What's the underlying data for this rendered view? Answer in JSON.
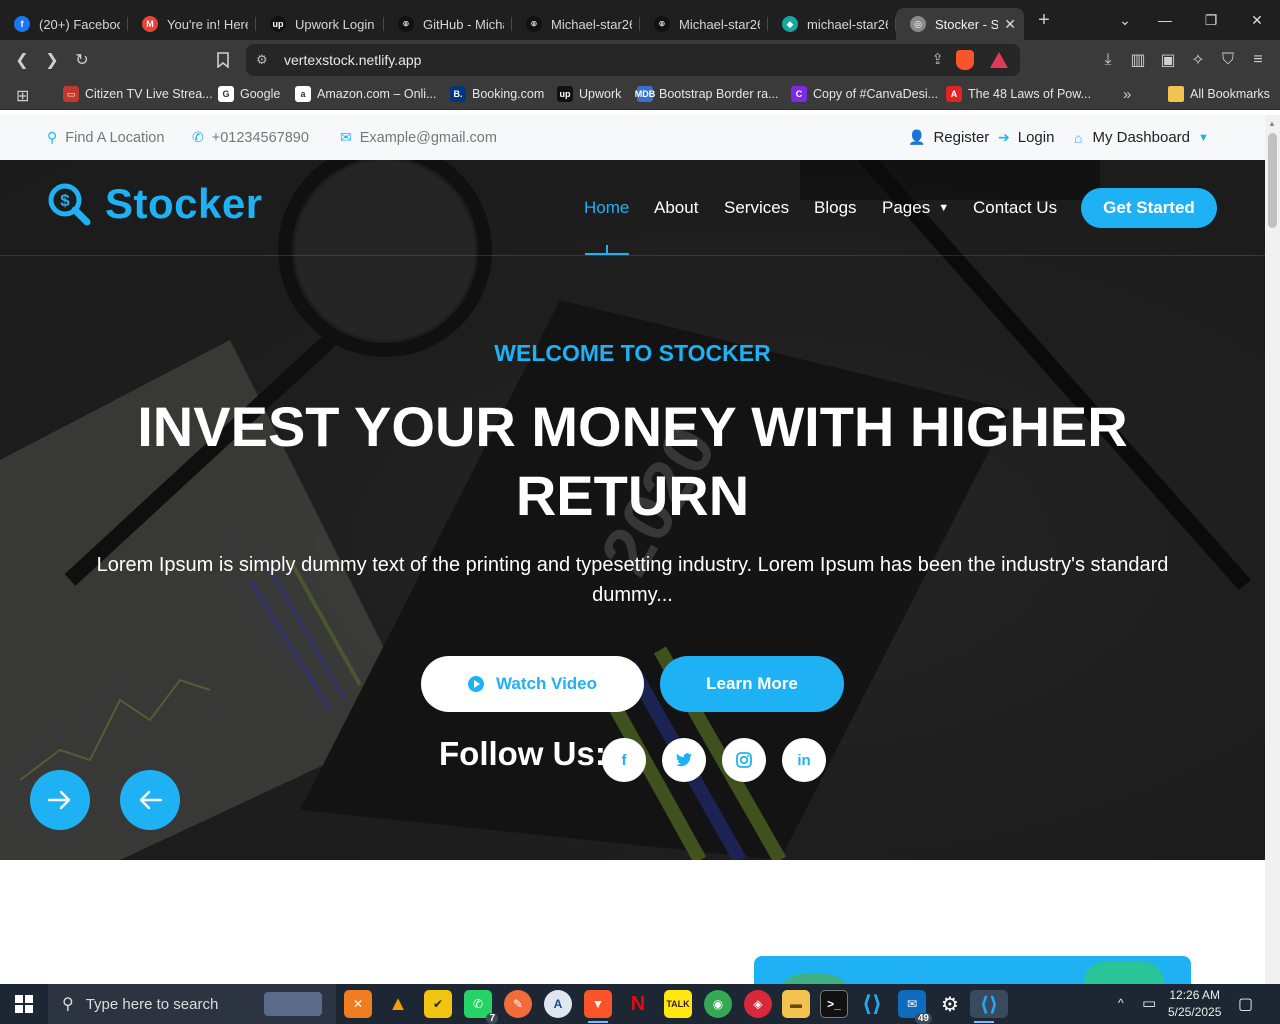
{
  "browser": {
    "tabs": [
      {
        "label": "(20+) Facebook",
        "favicon": "facebook-icon",
        "color": "#1877f2",
        "glyph": "f"
      },
      {
        "label": "You're in! Here",
        "favicon": "gmail-icon",
        "color": "#ea4335",
        "glyph": "M"
      },
      {
        "label": "Upwork Login",
        "favicon": "upwork-icon",
        "color": "#111111",
        "glyph": "up"
      },
      {
        "label": "GitHub - Micha",
        "favicon": "github-icon",
        "color": "#111111",
        "glyph": "⌾"
      },
      {
        "label": "Michael-star26",
        "favicon": "github-icon",
        "color": "#111111",
        "glyph": "⌾"
      },
      {
        "label": "Michael-star26",
        "favicon": "github-icon",
        "color": "#111111",
        "glyph": "⌾"
      },
      {
        "label": "michael-star26",
        "favicon": "netlify-icon",
        "color": "#14a8a0",
        "glyph": "◆"
      },
      {
        "label": "Stocker - S",
        "favicon": "globe-icon",
        "color": "#8a8a8a",
        "glyph": "◎"
      }
    ],
    "url": "vertexstock.netlify.app",
    "bookmarks": [
      {
        "label": "Citizen TV Live Strea...",
        "icon": "citizen-tv-icon",
        "color": "#c0392b",
        "glyph": "▭"
      },
      {
        "label": "Google",
        "icon": "google-icon",
        "color": "#ffffff",
        "glyph": "G"
      },
      {
        "label": "Amazon.com – Onli...",
        "icon": "amazon-icon",
        "color": "#ffffff",
        "glyph": "a"
      },
      {
        "label": "Booking.com",
        "icon": "booking-icon",
        "color": "#003580",
        "glyph": "B."
      },
      {
        "label": "Upwork",
        "icon": "upwork-icon",
        "color": "#111111",
        "glyph": "up"
      },
      {
        "label": "Bootstrap Border ra...",
        "icon": "mdb-icon",
        "color": "#3b71ca",
        "glyph": "MDB"
      },
      {
        "label": "Copy of #CanvaDesi...",
        "icon": "canva-icon",
        "color": "#7d2ae8",
        "glyph": "C"
      },
      {
        "label": "The 48 Laws of Pow...",
        "icon": "pdf-icon",
        "color": "#e02424",
        "glyph": "A"
      }
    ],
    "all_bookmarks": "All Bookmarks"
  },
  "site": {
    "topbar": {
      "location": "Find A Location",
      "phone": "+01234567890",
      "email": "Example@gmail.com",
      "register": "Register",
      "login": "Login",
      "dashboard": "My Dashboard"
    },
    "brand": "Stocker",
    "nav": [
      "Home",
      "About",
      "Services",
      "Blogs",
      "Pages",
      "Contact Us"
    ],
    "cta": "Get Started",
    "hero": {
      "eyebrow": "WELCOME TO STOCKER",
      "headline": "INVEST YOUR MONEY WITH HIGHER RETURN",
      "lead": "Lorem Ipsum is simply dummy text of the printing and typesetting industry. Lorem Ipsum has been the industry's standard dummy...",
      "watch_video": "Watch Video",
      "learn_more": "Learn More",
      "follow_us": "Follow Us:",
      "social": [
        {
          "name": "facebook",
          "glyph": "f"
        },
        {
          "name": "twitter",
          "glyph": "🐦"
        },
        {
          "name": "instagram",
          "glyph": "◎"
        },
        {
          "name": "linkedin",
          "glyph": "in"
        }
      ]
    },
    "colors": {
      "accent": "#1eb2f5",
      "hero_bg": "#2e2e2e"
    }
  },
  "taskbar": {
    "search_placeholder": "Type here to search",
    "time": "12:26 AM",
    "date": "5/25/2025",
    "whatsapp_badge": "7",
    "mail_badge": "49"
  }
}
